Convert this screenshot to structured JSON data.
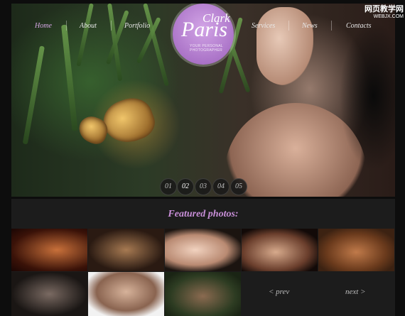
{
  "nav": {
    "items": [
      "Home",
      "About",
      "Portfolio",
      "Services",
      "News",
      "Contacts"
    ],
    "active": "Home"
  },
  "logo": {
    "name_top": "Clark",
    "name_main": "Paris",
    "tagline": "YOUR PERSONAL PHOTOGRAPHER"
  },
  "slider": {
    "pages": [
      "01",
      "02",
      "03",
      "04",
      "05"
    ],
    "current": "02"
  },
  "watermark": {
    "line1": "网页教学网",
    "line2": "WEBJX.COM"
  },
  "featured": {
    "title": "Featured photos:",
    "prev_label": "< prev",
    "next_label": "next >"
  },
  "colors": {
    "accent": "#c98fd9",
    "logo": "#b27fd0",
    "background": "#1c1c1c"
  }
}
